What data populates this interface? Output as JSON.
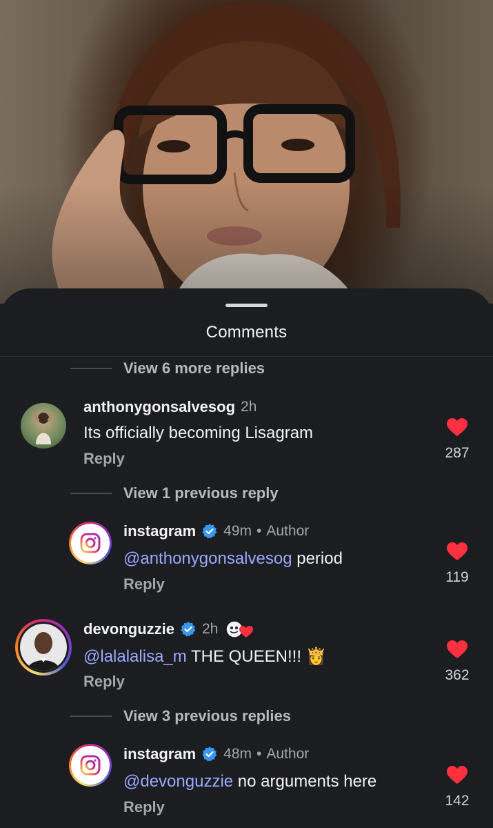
{
  "sheet": {
    "title": "Comments"
  },
  "view_replies": [
    {
      "label": "View 6 more replies"
    },
    {
      "label": "View 1 previous reply"
    },
    {
      "label": "View 3 previous replies"
    }
  ],
  "comments": [
    {
      "user": "anthonygonsalvesog",
      "time": "2h",
      "text": "Its officially becoming Lisagram",
      "reply_label": "Reply",
      "likes": "287"
    },
    {
      "user": "instagram",
      "time": "49m",
      "separator": "•",
      "author_tag": "Author",
      "mention": "@anthonygonsalvesog",
      "text": " period",
      "reply_label": "Reply",
      "likes": "119"
    },
    {
      "user": "devonguzzie",
      "time": "2h",
      "mention": "@lalalalisa_m",
      "text": " THE QUEEN!!! ",
      "emoji": "👸",
      "reply_label": "Reply",
      "likes": "362"
    },
    {
      "user": "instagram",
      "time": "48m",
      "separator": "•",
      "author_tag": "Author",
      "mention": "@devonguzzie",
      "text": " no arguments here",
      "reply_label": "Reply",
      "likes": "142"
    }
  ],
  "colors": {
    "background": "#1c1d20",
    "mention": "#9aa8ff",
    "heart": "#ff3040",
    "verified": "#3897f0"
  },
  "icons": [
    "heart-icon",
    "verified-badge-icon",
    "instagram-logo-icon",
    "creator-heart-icon"
  ]
}
